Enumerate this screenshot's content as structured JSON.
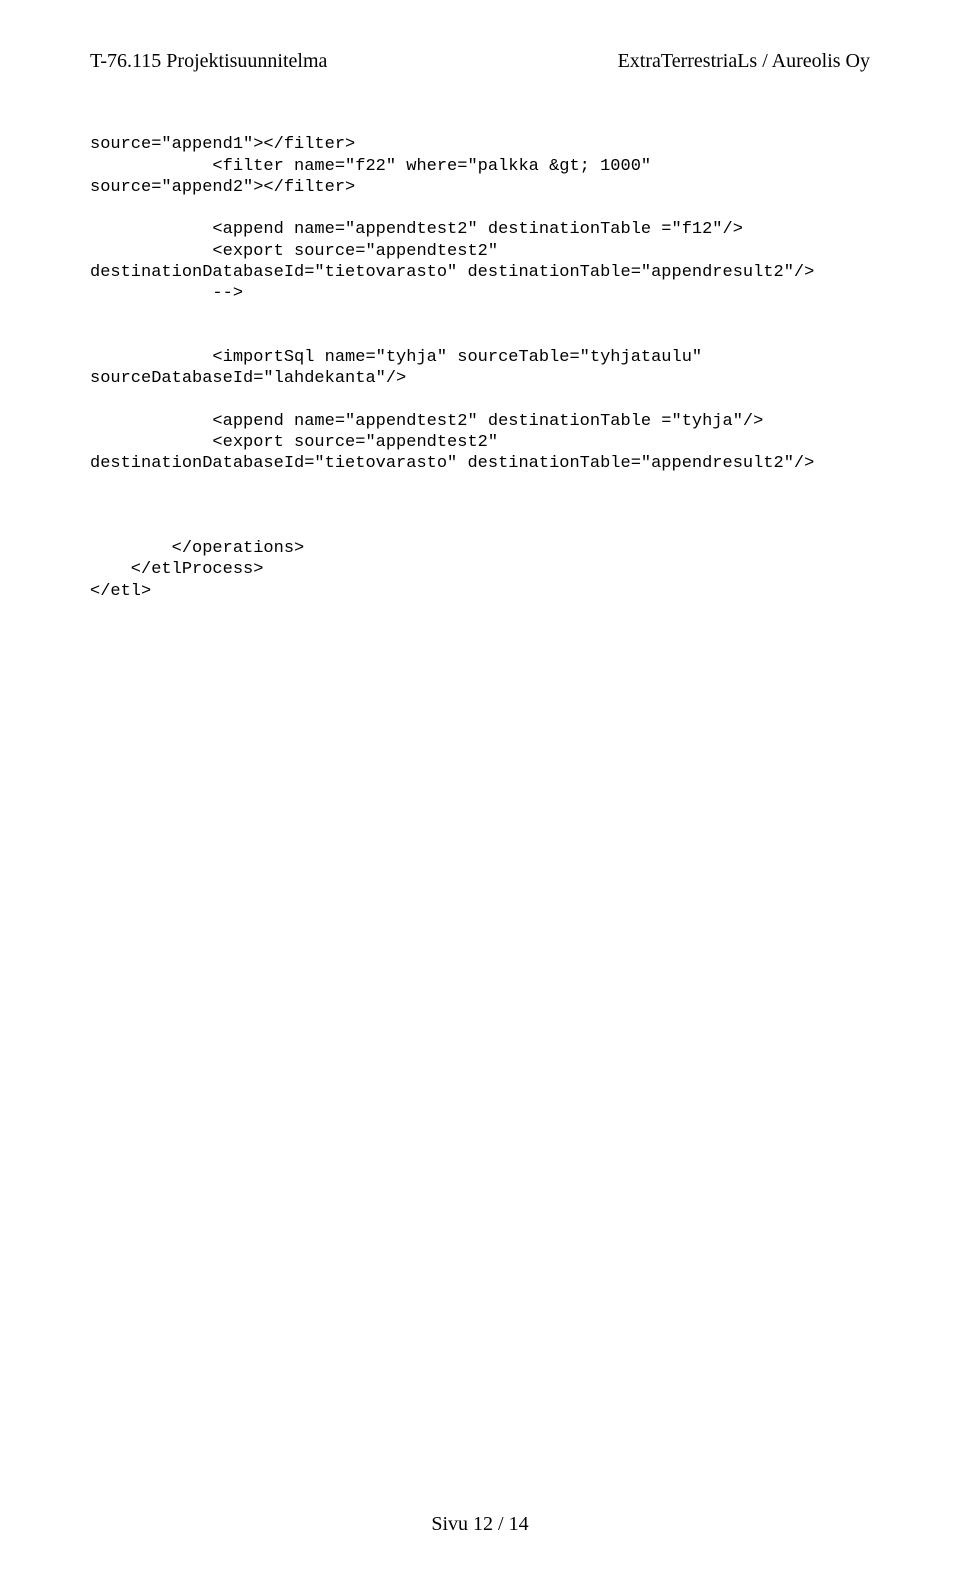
{
  "header": {
    "left": "T-76.115 Projektisuunnitelma",
    "right": "ExtraTerrestriaLs / Aureolis Oy"
  },
  "code": {
    "line1": "source=\"append1\"></filter>",
    "line2": "            <filter name=\"f22\" where=\"palkka &gt; 1000\"",
    "line3": "source=\"append2\"></filter>",
    "line4": "",
    "line5": "            <append name=\"appendtest2\" destinationTable =\"f12\"/>",
    "line6": "            <export source=\"appendtest2\"",
    "line7": "destinationDatabaseId=\"tietovarasto\" destinationTable=\"appendresult2\"/>",
    "line8": "            -->",
    "line9": "",
    "line10": "",
    "line11": "            <importSql name=\"tyhja\" sourceTable=\"tyhjataulu\"",
    "line12": "sourceDatabaseId=\"lahdekanta\"/>",
    "line13": "",
    "line14": "            <append name=\"appendtest2\" destinationTable =\"tyhja\"/>",
    "line15": "            <export source=\"appendtest2\"",
    "line16": "destinationDatabaseId=\"tietovarasto\" destinationTable=\"appendresult2\"/>",
    "line17": "",
    "line18": "",
    "line19": "",
    "line20": "        </operations>",
    "line21": "    </etlProcess>",
    "line22": "</etl>"
  },
  "footer": {
    "page": "Sivu 12 / 14"
  }
}
